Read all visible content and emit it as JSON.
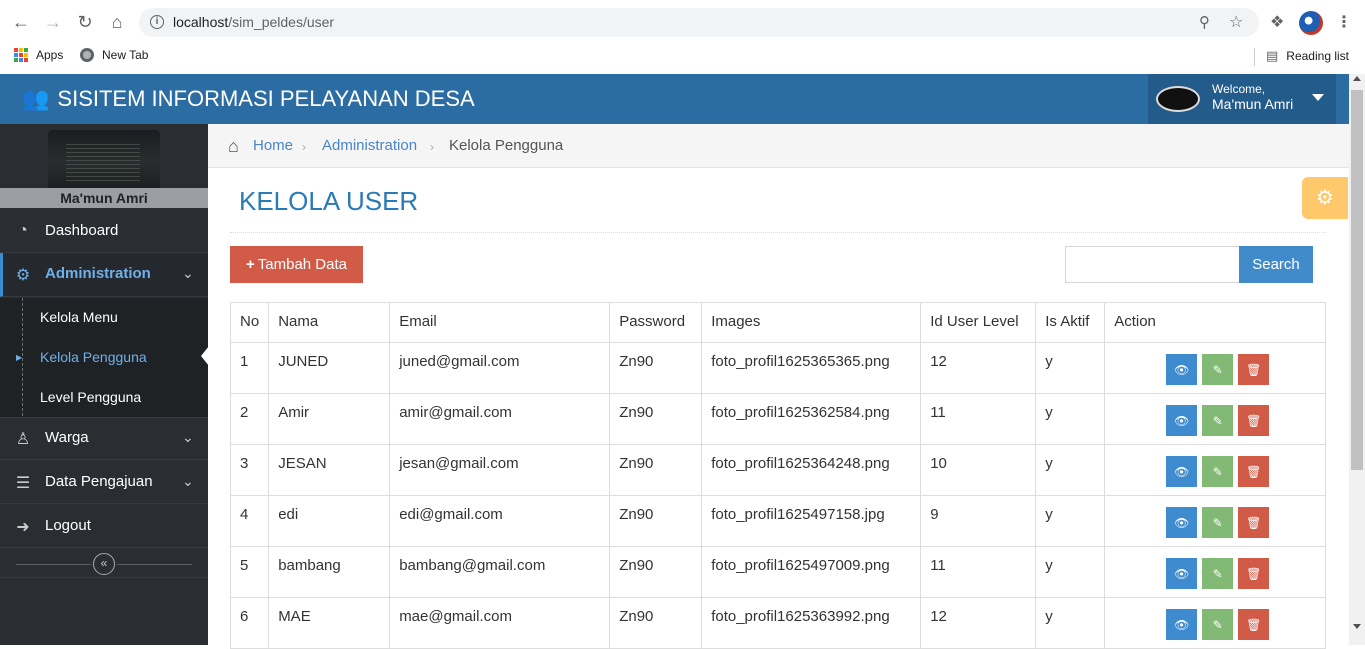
{
  "browser": {
    "url_host": "localhost",
    "url_path": "/sim_peldes/user",
    "bookmarks": [
      "Apps",
      "New Tab"
    ],
    "reading_list": "Reading list"
  },
  "header": {
    "brand": "SISITEM INFORMASI PELAYANAN DESA",
    "welcome": "Welcome,",
    "user_name": "Ma'mun Amri",
    "accent": "#2b6ca3"
  },
  "sidebar": {
    "user_name": "Ma'mun Amri",
    "items": [
      {
        "label": "Dashboard",
        "icon": "dashboard-icon"
      },
      {
        "label": "Administration",
        "icon": "gear-icon"
      },
      {
        "label": "Warga",
        "icon": "user-icon"
      },
      {
        "label": "Data Pengajuan",
        "icon": "server-icon"
      },
      {
        "label": "Logout",
        "icon": "logout-icon"
      }
    ],
    "subitems": [
      "Kelola Menu",
      "Kelola Pengguna",
      "Level Pengguna"
    ]
  },
  "breadcrumb": {
    "home": "Home",
    "section": "Administration",
    "current": "Kelola Pengguna"
  },
  "page": {
    "title": "KELOLA USER",
    "add_label": "Tambah Data",
    "search_label": "Search",
    "search_value": ""
  },
  "table": {
    "headers": [
      "No",
      "Nama",
      "Email",
      "Password",
      "Images",
      "Id User Level",
      "Is Aktif",
      "Action"
    ],
    "rows": [
      [
        "1",
        "JUNED",
        "juned@gmail.com",
        "Zn90",
        "foto_profil1625365365.png",
        "12",
        "y"
      ],
      [
        "2",
        "Amir",
        "amir@gmail.com",
        "Zn90",
        "foto_profil1625362584.png",
        "11",
        "y"
      ],
      [
        "3",
        "JESAN",
        "jesan@gmail.com",
        "Zn90",
        "foto_profil1625364248.png",
        "10",
        "y"
      ],
      [
        "4",
        "edi",
        "edi@gmail.com",
        "Zn90",
        "foto_profil1625497158.jpg",
        "9",
        "y"
      ],
      [
        "5",
        "bambang",
        "bambang@gmail.com",
        "Zn90",
        "foto_profil1625497009.png",
        "11",
        "y"
      ],
      [
        "6",
        "MAE",
        "mae@gmail.com",
        "Zn90",
        "foto_profil1625363992.png",
        "12",
        "y"
      ]
    ]
  }
}
